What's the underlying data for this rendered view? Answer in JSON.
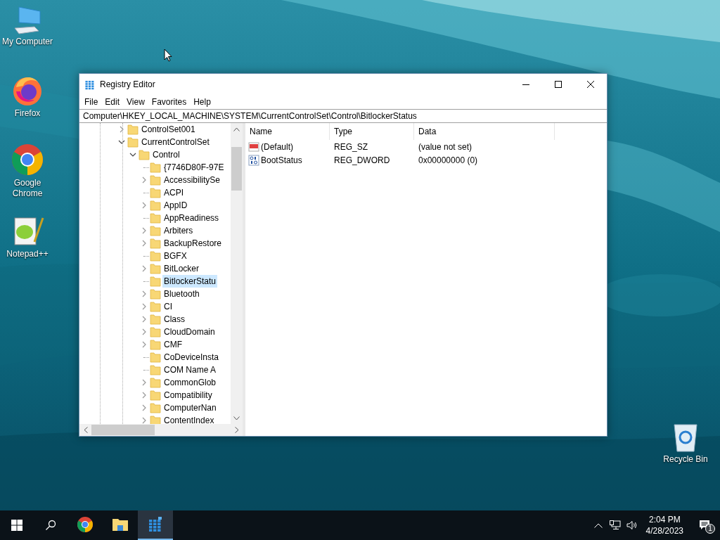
{
  "desktop_icons": [
    {
      "kind": "computer",
      "label": "My Computer"
    },
    {
      "kind": "firefox",
      "label": "Firefox"
    },
    {
      "kind": "chrome",
      "label": "Google Chrome"
    },
    {
      "kind": "notepad",
      "label": "Notepad++"
    },
    {
      "kind": "recycle",
      "label": "Recycle Bin"
    }
  ],
  "window": {
    "title": "Registry Editor",
    "menu": [
      "File",
      "Edit",
      "View",
      "Favorites",
      "Help"
    ],
    "address": "Computer\\HKEY_LOCAL_MACHINE\\SYSTEM\\CurrentControlSet\\Control\\BitlockerStatus",
    "tree": [
      {
        "label": "ControlSet001",
        "expanded": false,
        "selected": false
      },
      {
        "label": "CurrentControlSet",
        "expanded": true,
        "selected": false,
        "children": [
          {
            "label": "Control",
            "expanded": true,
            "selected": false,
            "children": [
              {
                "label": "{7746D80F-97E",
                "selected": false
              },
              {
                "label": "AccessibilitySe",
                "expanded": false,
                "selected": false
              },
              {
                "label": "ACPI",
                "selected": false
              },
              {
                "label": "AppID",
                "expanded": false,
                "selected": false
              },
              {
                "label": "AppReadiness",
                "selected": false
              },
              {
                "label": "Arbiters",
                "expanded": false,
                "selected": false
              },
              {
                "label": "BackupRestore",
                "expanded": false,
                "selected": false
              },
              {
                "label": "BGFX",
                "selected": false
              },
              {
                "label": "BitLocker",
                "expanded": false,
                "selected": false
              },
              {
                "label": "BitlockerStatu",
                "selected": true
              },
              {
                "label": "Bluetooth",
                "expanded": false,
                "selected": false
              },
              {
                "label": "CI",
                "expanded": false,
                "selected": false
              },
              {
                "label": "Class",
                "expanded": false,
                "selected": false
              },
              {
                "label": "CloudDomain",
                "expanded": false,
                "selected": false
              },
              {
                "label": "CMF",
                "expanded": false,
                "selected": false
              },
              {
                "label": "CoDeviceInsta",
                "selected": false
              },
              {
                "label": "COM Name A",
                "selected": false
              },
              {
                "label": "CommonGlob",
                "expanded": false,
                "selected": false
              },
              {
                "label": "Compatibility",
                "expanded": false,
                "selected": false
              },
              {
                "label": "ComputerNan",
                "expanded": false,
                "selected": false
              },
              {
                "label": "ContentIndex",
                "expanded": false,
                "selected": false
              }
            ]
          }
        ]
      }
    ],
    "columns": [
      "Name",
      "Type",
      "Data"
    ],
    "values": [
      {
        "kind": "string",
        "name": "(Default)",
        "type": "REG_SZ",
        "data": "(value not set)"
      },
      {
        "kind": "binary",
        "name": "BootStatus",
        "type": "REG_DWORD",
        "data": "0x00000000 (0)"
      }
    ]
  },
  "taskbar": {
    "apps": [
      {
        "kind": "chrome",
        "selected": false
      },
      {
        "kind": "explorer",
        "selected": false
      },
      {
        "kind": "regedit",
        "selected": true
      }
    ],
    "time": "2:04 PM",
    "date": "4/28/2023",
    "notifications": "1"
  }
}
